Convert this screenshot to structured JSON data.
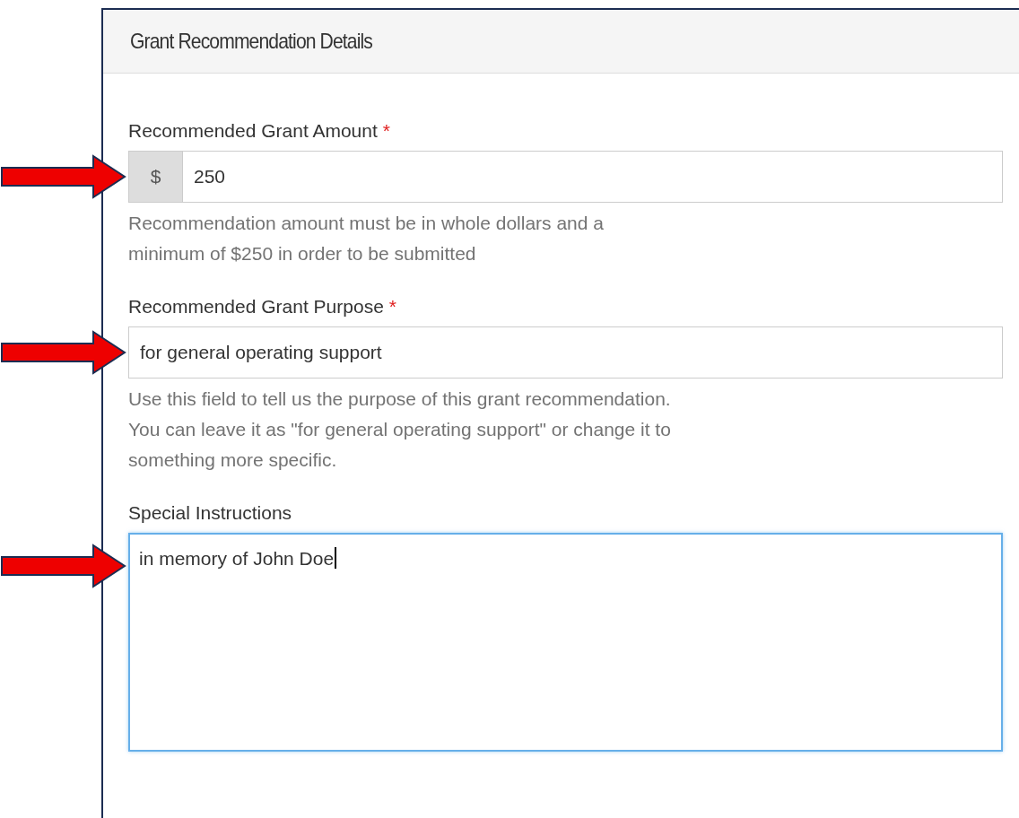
{
  "panel": {
    "title": "Grant Recommendation Details"
  },
  "fields": [
    {
      "kind": "addon-input",
      "label": "Recommended Grant Amount",
      "required_mark": "*",
      "addon": "$",
      "value": "250",
      "help": [
        "Recommendation amount must be in whole dollars and a",
        "minimum of $250 in order to be submitted"
      ],
      "pointer_arrow": true,
      "focused": false
    },
    {
      "kind": "input",
      "label": "Recommended Grant Purpose",
      "required_mark": "*",
      "value": "for general operating support",
      "help": [
        "Use this field to tell us the purpose of this grant recommendation.",
        "You can leave it as \"for general operating support\" or change it to",
        "something more specific."
      ],
      "pointer_arrow": true,
      "focused": false
    },
    {
      "kind": "textarea",
      "label": "Special Instructions",
      "value": "in memory of John Doe",
      "pointer_arrow": true,
      "focused": true
    }
  ]
}
